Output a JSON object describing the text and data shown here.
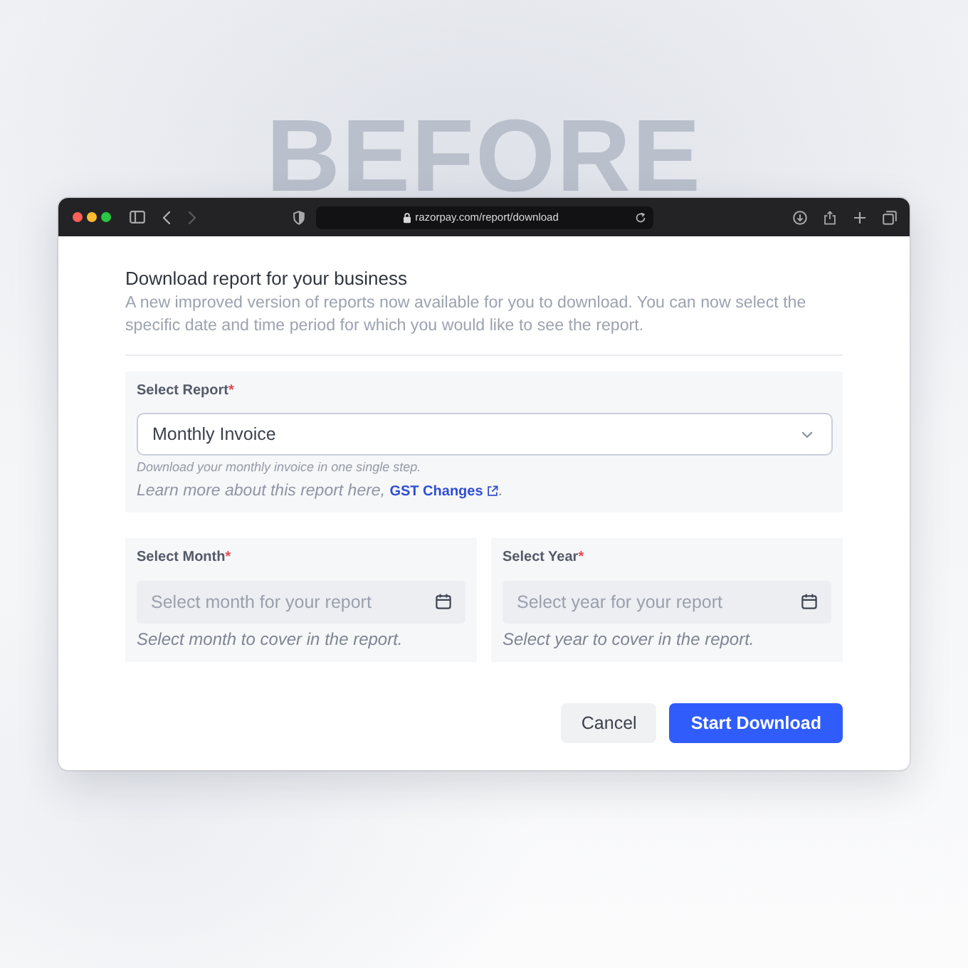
{
  "backdrop_label": "BEFORE",
  "browser": {
    "nav_buttons": [
      {
        "kind": "back",
        "disabled": false
      },
      {
        "kind": "forward",
        "disabled": true
      }
    ],
    "url": "razorpay.com/report/download"
  },
  "header": {
    "title": "Download report for your business",
    "description": "A new improved version of reports now available for you to download. You can now select the specific date and time period for which you would like to see the report."
  },
  "report_select": {
    "label": "Select Report",
    "required_mark": "*",
    "value": "Monthly Invoice",
    "hint": "Download your monthly invoice in one single step.",
    "learn_more": {
      "text": "Learn more about this report here,",
      "link": "GST Changes",
      "suffix": "."
    }
  },
  "date_fields": [
    {
      "label": "Select Month",
      "required_mark": "*",
      "placeholder": "Select month for your report",
      "hint": "Select month to cover in the report."
    },
    {
      "label": "Select Year",
      "required_mark": "*",
      "placeholder": "Select year for your report",
      "hint": "Select year to cover in the report."
    }
  ],
  "buttons": [
    {
      "label": "Cancel",
      "kind": "secondary"
    },
    {
      "label": "Start Download",
      "kind": "primary"
    }
  ]
}
